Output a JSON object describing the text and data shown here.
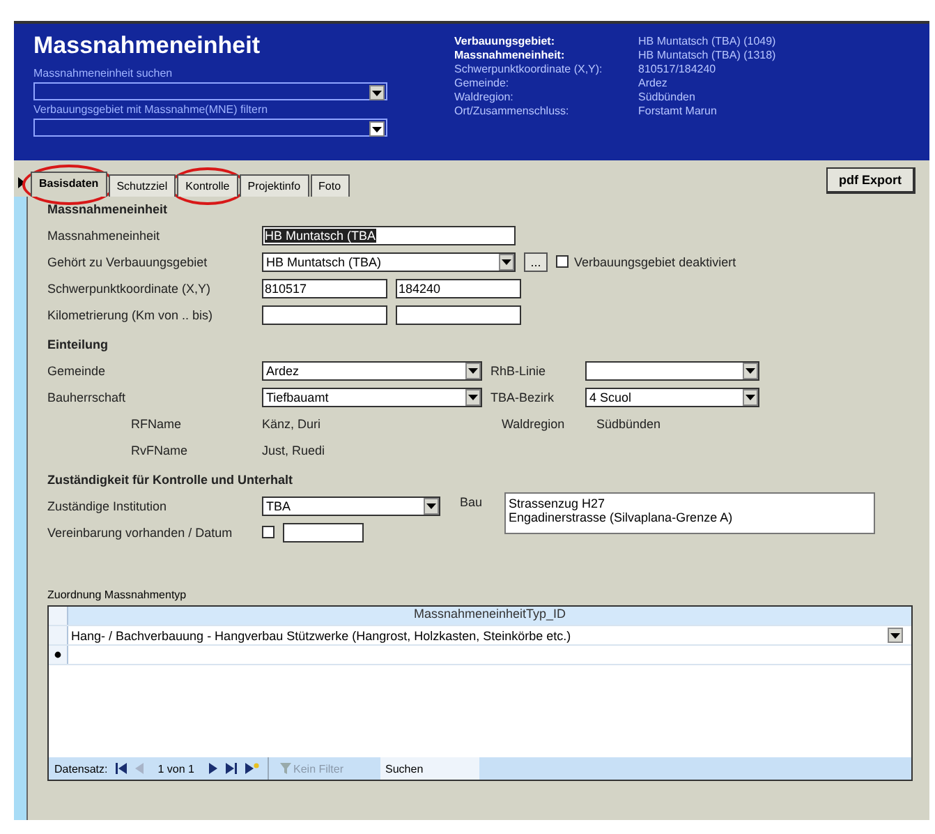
{
  "header": {
    "title": "Massnahmeneinheit",
    "search_label": "Massnahmeneinheit suchen",
    "filter_label": "Verbauungsgebiet mit Massnahme(MNE) filtern"
  },
  "info": [
    {
      "label": "Verbauungsgebiet:",
      "value": "HB Muntatsch (TBA) (1049)",
      "emphasis": true
    },
    {
      "label": "Massnahmeneinheit:",
      "value": "HB Muntatsch (TBA) (1318)",
      "emphasis": true
    },
    {
      "label": "Schwerpunktkoordinate (X,Y):",
      "value": "810517/184240",
      "emphasis": false
    },
    {
      "label": "Gemeinde:",
      "value": "Ardez",
      "emphasis": false
    },
    {
      "label": "Waldregion:",
      "value": "Südbünden",
      "emphasis": false
    },
    {
      "label": "Ort/Zusammenschluss:",
      "value": "Forstamt Marun",
      "emphasis": false
    }
  ],
  "tabs": [
    {
      "label": "Basisdaten",
      "selected": true,
      "circled": true
    },
    {
      "label": "Schutzziel",
      "selected": false,
      "circled": false
    },
    {
      "label": "Kontrolle",
      "selected": false,
      "circled": true
    },
    {
      "label": "Projektinfo",
      "selected": false,
      "circled": false
    },
    {
      "label": "Foto",
      "selected": false,
      "circled": false
    }
  ],
  "export_button": "pdf Export",
  "sections": [
    {
      "title": "Massnahmeneinheit",
      "rows": [
        [
          {
            "kind": "label",
            "text": "Massnahmeneinheit"
          },
          {
            "kind": "field",
            "value": "HB Muntatsch (TBA",
            "selected": true
          }
        ],
        [
          {
            "kind": "label",
            "text": "Gehört zu Verbauungsgebiet"
          },
          {
            "kind": "combo",
            "value": "HB Muntatsch (TBA)"
          },
          {
            "kind": "button",
            "text": "..."
          },
          {
            "kind": "checkbox",
            "text": "Verbauungsgebiet deaktiviert",
            "checked": false
          }
        ],
        [
          {
            "kind": "label",
            "text": "Schwerpunktkoordinate (X,Y)"
          },
          {
            "kind": "field",
            "value": "810517",
            "selected": false
          },
          {
            "kind": "field",
            "value": "184240",
            "selected": false
          }
        ],
        [
          {
            "kind": "label",
            "text": "Kilometrierung (Km von .. bis)"
          },
          {
            "kind": "field"
          },
          {
            "kind": "field"
          }
        ]
      ]
    },
    {
      "title": "Einteilung",
      "rows": [
        [
          {
            "kind": "label",
            "text": "Gemeinde"
          },
          {
            "kind": "combo",
            "value": "Ardez"
          },
          {
            "kind": "label",
            "text": "RhB-Linie"
          },
          {
            "kind": "combo"
          }
        ],
        [
          {
            "kind": "label",
            "text": "Bauherrschaft"
          },
          {
            "kind": "combo",
            "value": "Tiefbauamt"
          },
          {
            "kind": "label",
            "text": "TBA-Bezirk"
          },
          {
            "kind": "combo",
            "value": "4 Scuol"
          }
        ],
        [
          {
            "kind": "sublabel",
            "text": "RFName"
          },
          {
            "kind": "value",
            "text": "Känz, Duri"
          },
          {
            "kind": "label",
            "text": "Waldregion"
          },
          {
            "kind": "value",
            "text": "Südbünden"
          }
        ],
        [
          {
            "kind": "sublabel",
            "text": "RvFName"
          },
          {
            "kind": "value",
            "text": "Just, Ruedi"
          }
        ]
      ]
    },
    {
      "title": "Zuständigkeit für Kontrolle und Unterhalt",
      "rows": [
        [
          {
            "kind": "label",
            "text": "Zuständige Institution"
          },
          {
            "kind": "combo",
            "value": "TBA"
          }
        ],
        [
          {
            "kind": "label",
            "text": "Vereinbarung vorhanden / Datum"
          },
          {
            "kind": "checkbox",
            "checked": false
          },
          {
            "kind": "field"
          }
        ]
      ],
      "side": {
        "label": "Bau",
        "lines": [
          "Strassenzug H27",
          "Engadinerstrasse (Silvaplana-Grenze A)"
        ]
      }
    }
  ],
  "subform": {
    "label": "Zuordnung Massnahmentyp",
    "column": "MassnahmeneinheitTyp_ID",
    "rows": [
      "Hang- / Bachverbauung - Hangverbau Stützwerke (Hangrost, Holzkasten, Steinkörbe etc.)"
    ],
    "nav": {
      "label": "Datensatz:",
      "position": "1 von 1",
      "filter": "Kein Filter",
      "search": "Suchen"
    }
  }
}
